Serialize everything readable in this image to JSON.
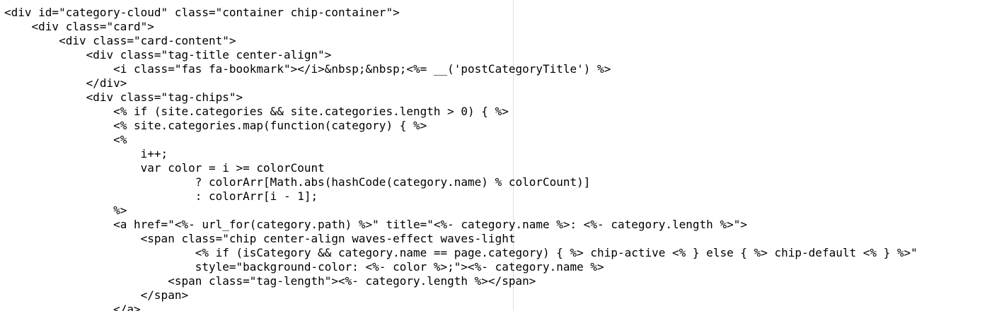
{
  "editor": {
    "current_line_index": 14,
    "lines": [
      "<div id=\"category-cloud\" class=\"container chip-container\">",
      "    <div class=\"card\">",
      "        <div class=\"card-content\">",
      "            <div class=\"tag-title center-align\">",
      "                <i class=\"fas fa-bookmark\"></i>&nbsp;&nbsp;<%= __('postCategoryTitle') %>",
      "            </div>",
      "            <div class=\"tag-chips\">",
      "                <% if (site.categories && site.categories.length > 0) { %>",
      "                <% site.categories.map(function(category) { %>",
      "                <%",
      "                    i++;",
      "                    var color = i >= colorCount",
      "                            ? colorArr[Math.abs(hashCode(category.name) % colorCount)]",
      "                            : colorArr[i - 1];",
      "                %>",
      "                <a href=\"<%- url_for(category.path) %>\" title=\"<%- category.name %>: <%- category.length %>\">",
      "                    <span class=\"chip center-align waves-effect waves-light",
      "                            <% if (isCategory && category.name == page.category) { %> chip-active <% } else { %> chip-default <% } %>\"",
      "                            style=\"background-color: <%- color %>;\"><%- category.name %>",
      "                        <span class=\"tag-length\"><%- category.length %></span>",
      "                    </span>",
      "                </a>"
    ]
  }
}
